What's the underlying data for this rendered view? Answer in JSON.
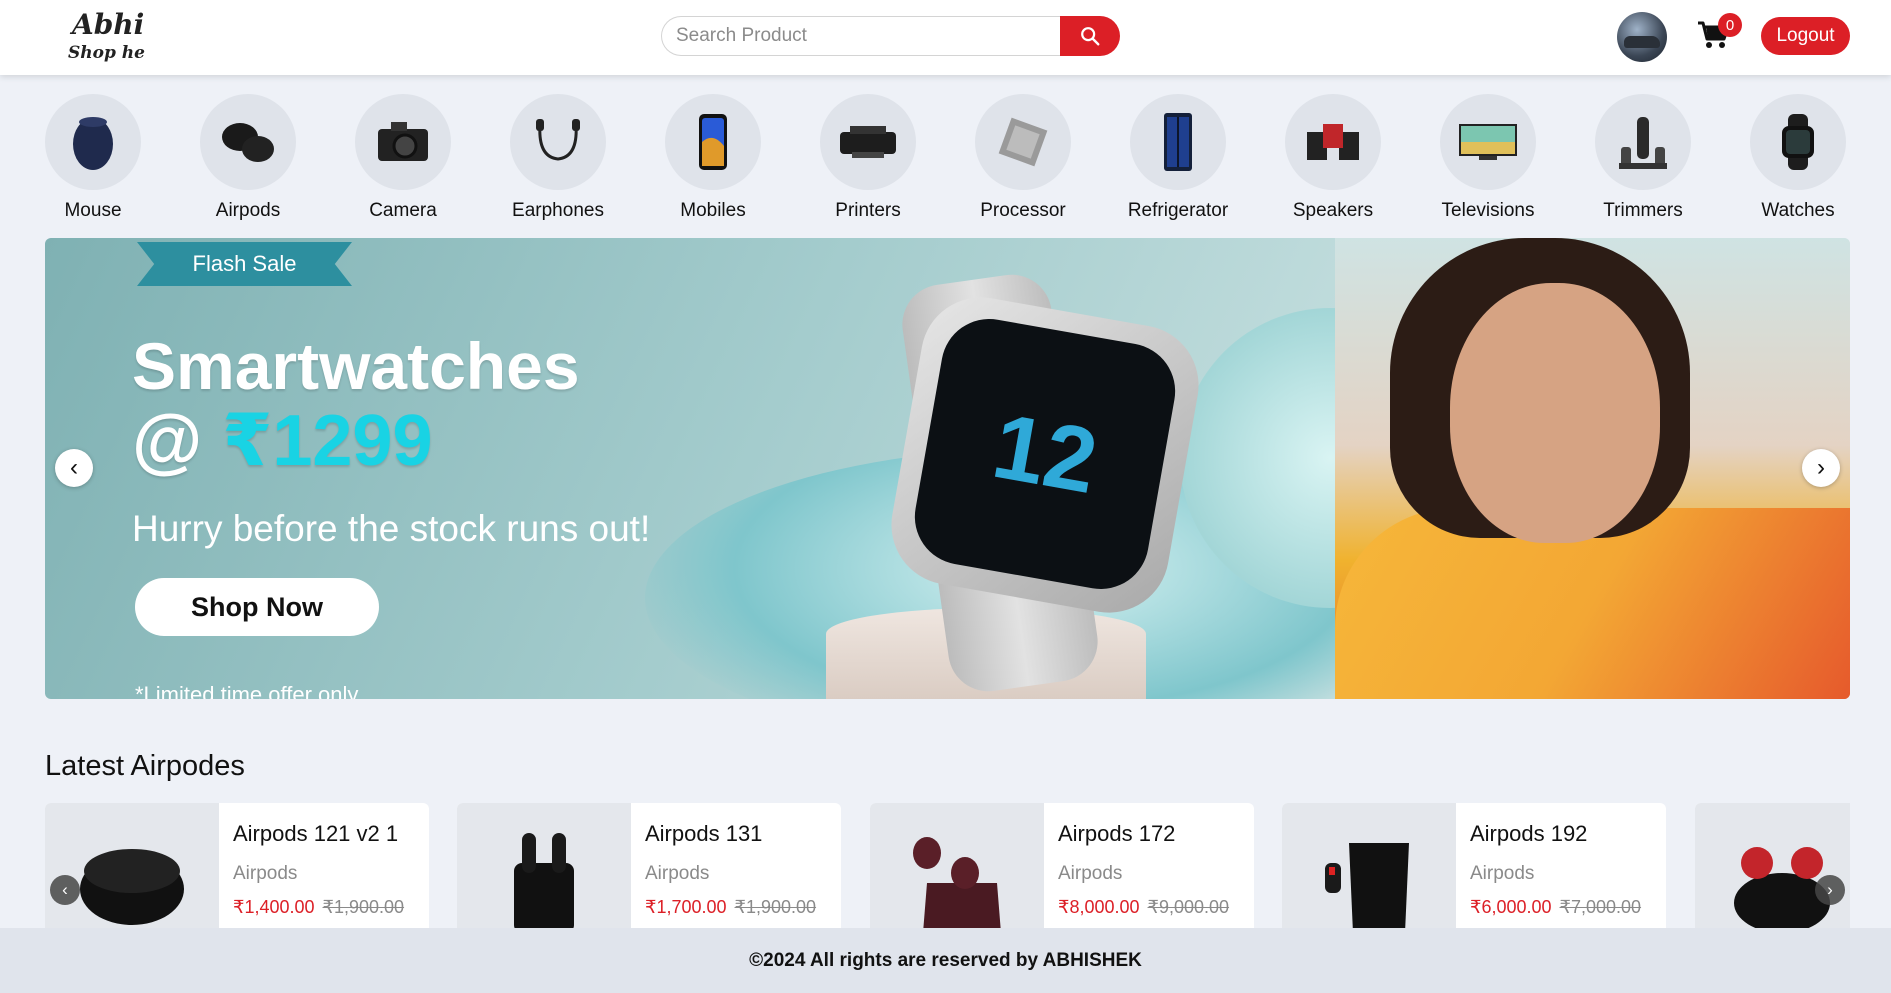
{
  "header": {
    "logo_line1": "Abhi",
    "logo_line2": "Shop here",
    "search_placeholder": "Search Product",
    "cart_count": "0",
    "logout_label": "Logout"
  },
  "categories": [
    {
      "label": "Mouse",
      "icon": "mouse-icon"
    },
    {
      "label": "Airpods",
      "icon": "airpods-icon"
    },
    {
      "label": "Camera",
      "icon": "camera-icon"
    },
    {
      "label": "Earphones",
      "icon": "earphones-icon"
    },
    {
      "label": "Mobiles",
      "icon": "mobile-icon"
    },
    {
      "label": "Printers",
      "icon": "printer-icon"
    },
    {
      "label": "Processor",
      "icon": "processor-icon"
    },
    {
      "label": "Refrigerator",
      "icon": "refrigerator-icon"
    },
    {
      "label": "Speakers",
      "icon": "speaker-icon"
    },
    {
      "label": "Televisions",
      "icon": "television-icon"
    },
    {
      "label": "Trimmers",
      "icon": "trimmer-icon"
    },
    {
      "label": "Watches",
      "icon": "watch-icon"
    }
  ],
  "banner": {
    "flash_label": "Flash Sale",
    "title": "Smartwatches",
    "price_prefix": "@",
    "price": "₹1299",
    "subtitle": "Hurry before the stock runs out!",
    "cta_label": "Shop Now",
    "note": "*Limited time offer only",
    "watch_face_text": "12"
  },
  "latest": {
    "title": "Latest Airpodes",
    "products": [
      {
        "name": "Airpods 121 v2 1",
        "category": "Airpods",
        "price": "₹1,400.00",
        "old_price": "₹1,900.00"
      },
      {
        "name": "Airpods 131",
        "category": "Airpods",
        "price": "₹1,700.00",
        "old_price": "₹1,900.00"
      },
      {
        "name": "Airpods 172",
        "category": "Airpods",
        "price": "₹8,000.00",
        "old_price": "₹9,000.00"
      },
      {
        "name": "Airpods 192",
        "category": "Airpods",
        "price": "₹6,000.00",
        "old_price": "₹7,000.00"
      }
    ]
  },
  "footer": {
    "text": "©2024 All rights are reserved by ABHISHEK"
  },
  "colors": {
    "accent": "#dc1f26",
    "page_bg": "#eef1f7",
    "banner_price": "#19d3e4"
  }
}
